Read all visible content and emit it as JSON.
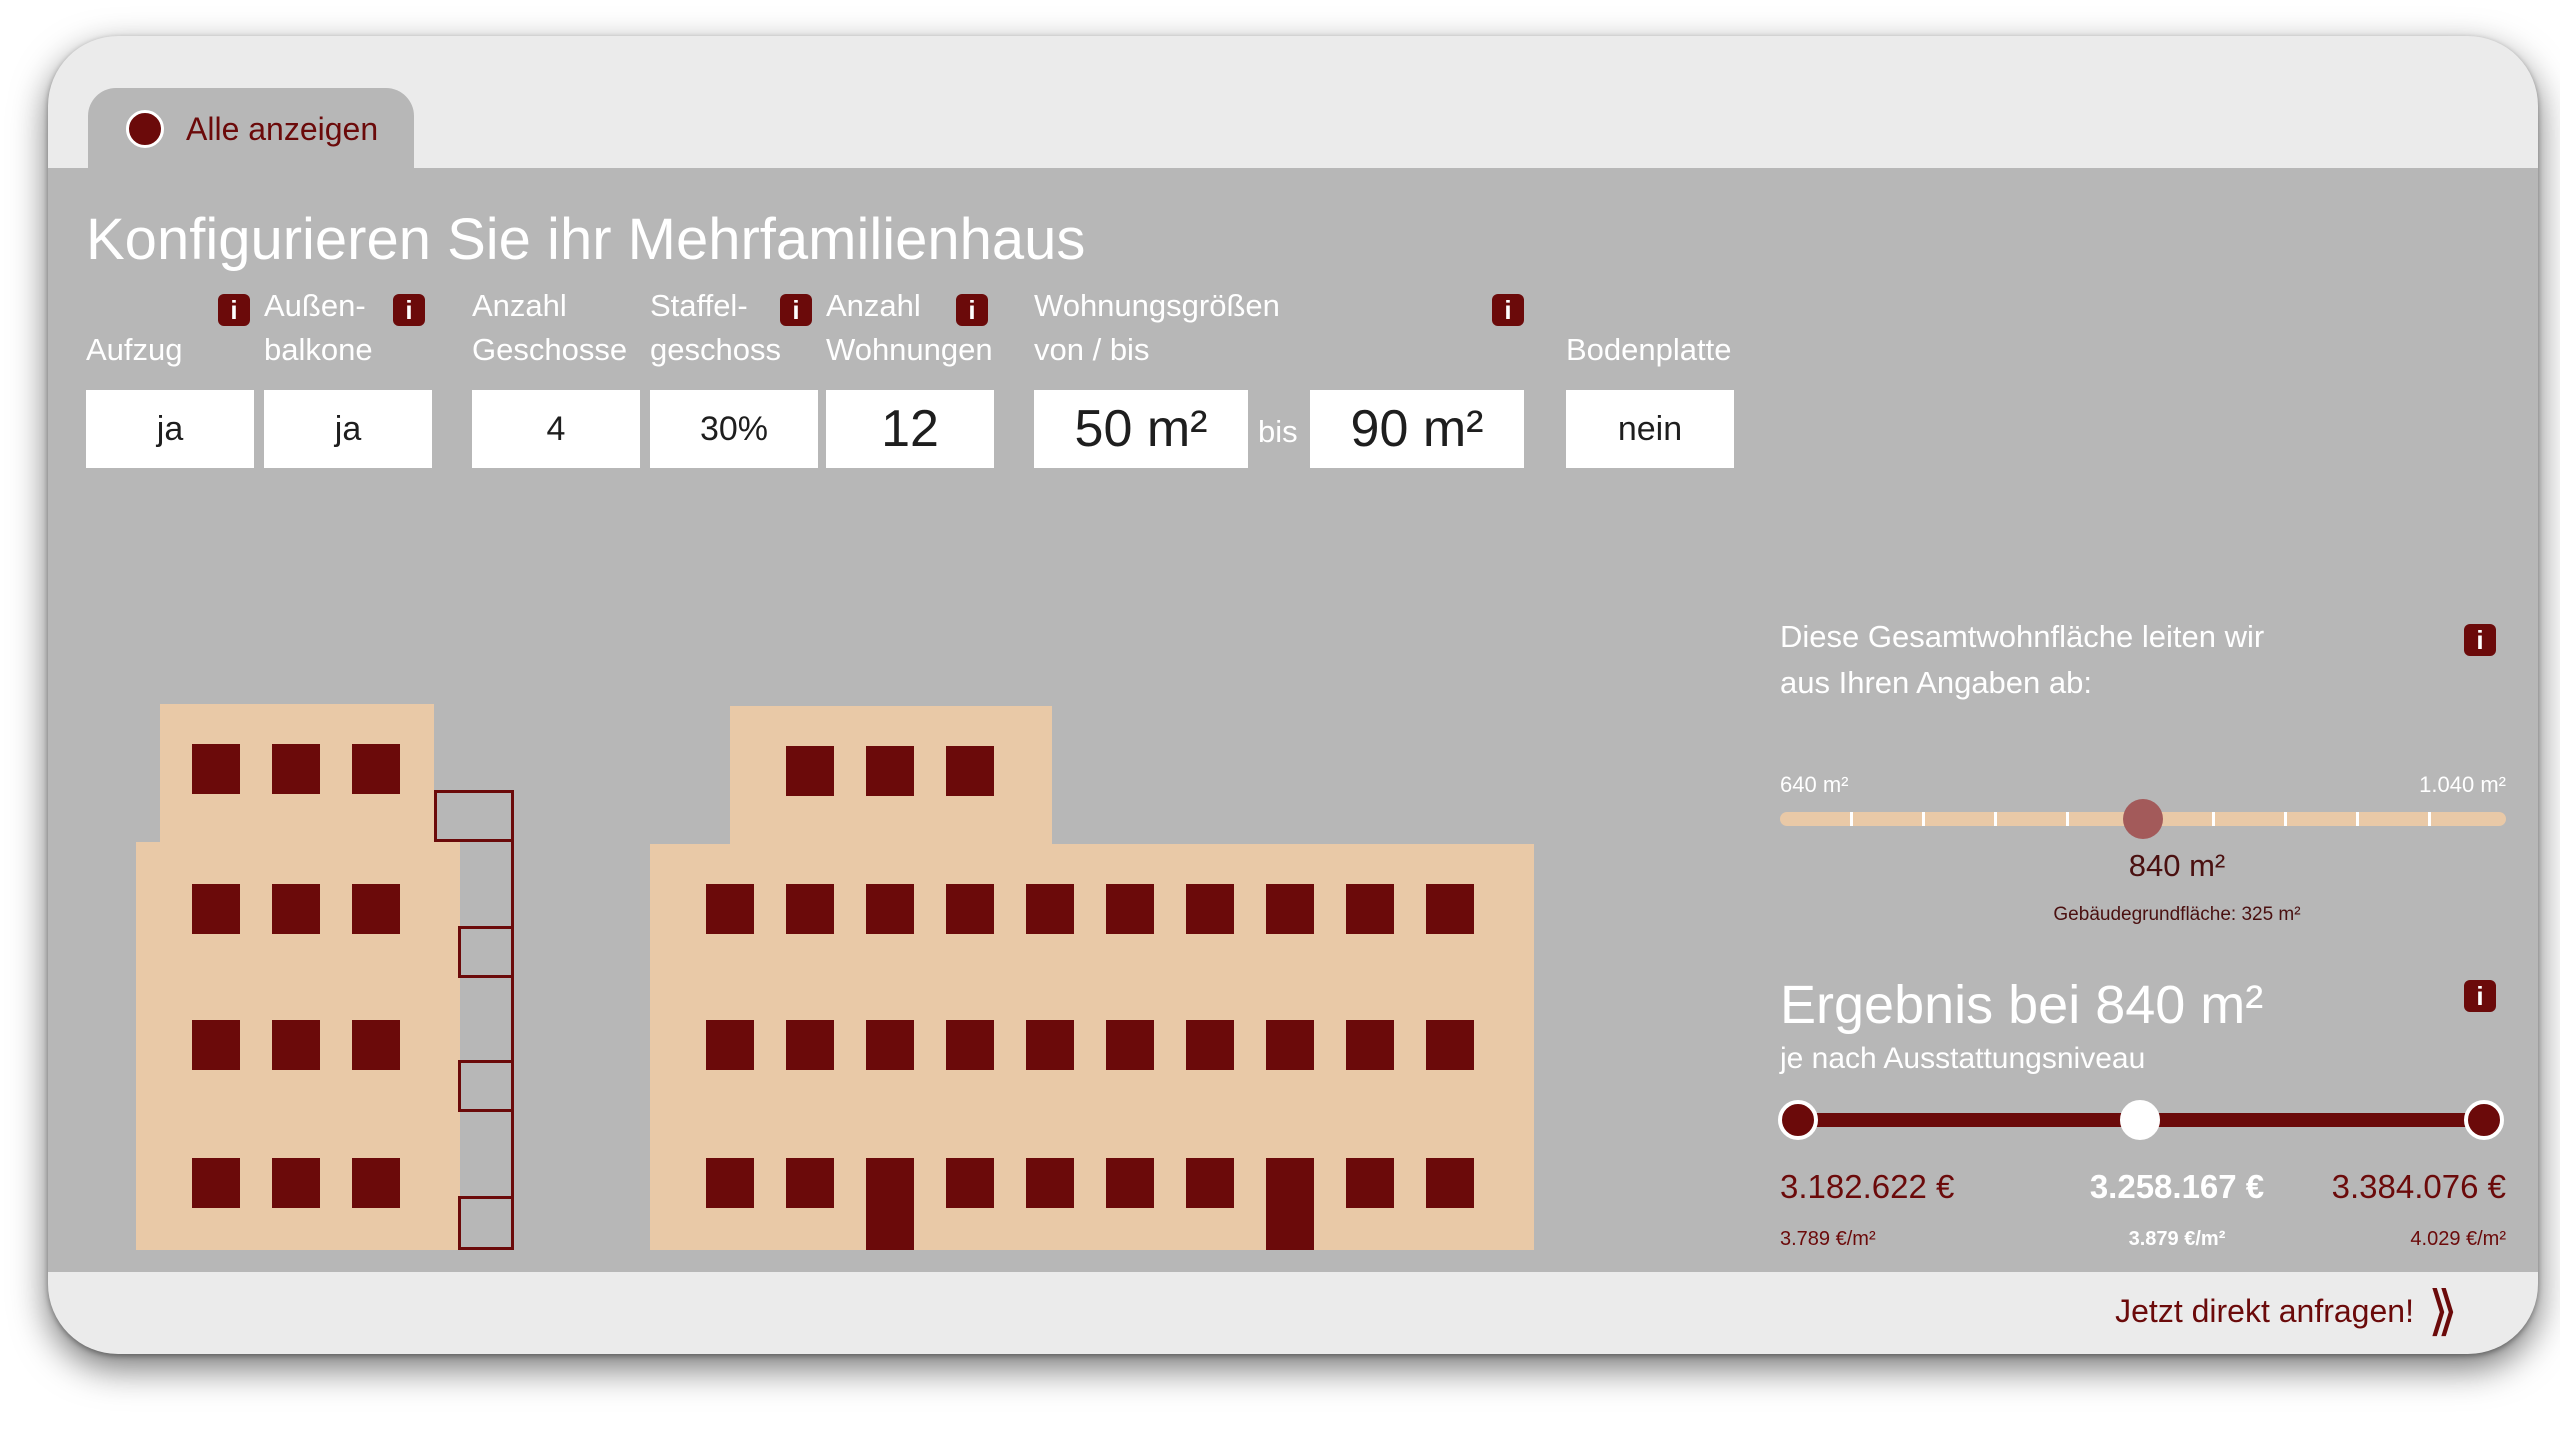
{
  "tab": {
    "label": "Alle anzeigen"
  },
  "title": "Konfigurieren Sie ihr Mehrfamilienhaus",
  "info_glyph": "i",
  "fields": {
    "aufzug": {
      "label": "Aufzug",
      "value": "ja"
    },
    "aussenbalkone": {
      "label_line1": "Außen-",
      "label_line2": "balkone",
      "value": "ja"
    },
    "anzahl_geschosse": {
      "label_line1": "Anzahl",
      "label_line2": "Geschosse",
      "value": "4"
    },
    "staffelgeschoss": {
      "label_line1": "Staffel-",
      "label_line2": "geschoss",
      "value": "30%"
    },
    "anzahl_wohnungen": {
      "label_line1": "Anzahl",
      "label_line2": "Wohnungen",
      "value": "12"
    },
    "wohnungsgroessen": {
      "label_line1": "Wohnungsgrößen",
      "label_line2": "von / bis",
      "from": "50 m²",
      "sep": "bis",
      "to": "90 m²"
    },
    "bodenplatte": {
      "label": "Bodenplatte",
      "value": "nein"
    }
  },
  "area": {
    "text_line1": "Diese Gesamtwohnfläche leiten wir",
    "text_line2": "aus Ihren Angaben ab:",
    "min": "640 m²",
    "max": "1.040 m²",
    "value": "840 m²",
    "value_fraction": 0.5,
    "footprint": "Gebäudegrundfläche: 325 m²"
  },
  "result": {
    "title": "Ergebnis bei 840 m²",
    "subtitle": "je nach Ausstattungsniveau",
    "prices": [
      {
        "total": "3.182.622 €",
        "per_m2": "3.789 €/m²"
      },
      {
        "total": "3.258.167 €",
        "per_m2": "3.879 €/m²"
      },
      {
        "total": "3.384.076 €",
        "per_m2": "4.029 €/m²"
      }
    ]
  },
  "cta": {
    "label": "Jetzt direkt anfragen!",
    "icon": "double-chevron-right-icon"
  },
  "colors": {
    "accent": "#6b0a0a",
    "panel": "#b7b7b7",
    "building": "#e9c9a7",
    "background": "#ebebeb"
  }
}
